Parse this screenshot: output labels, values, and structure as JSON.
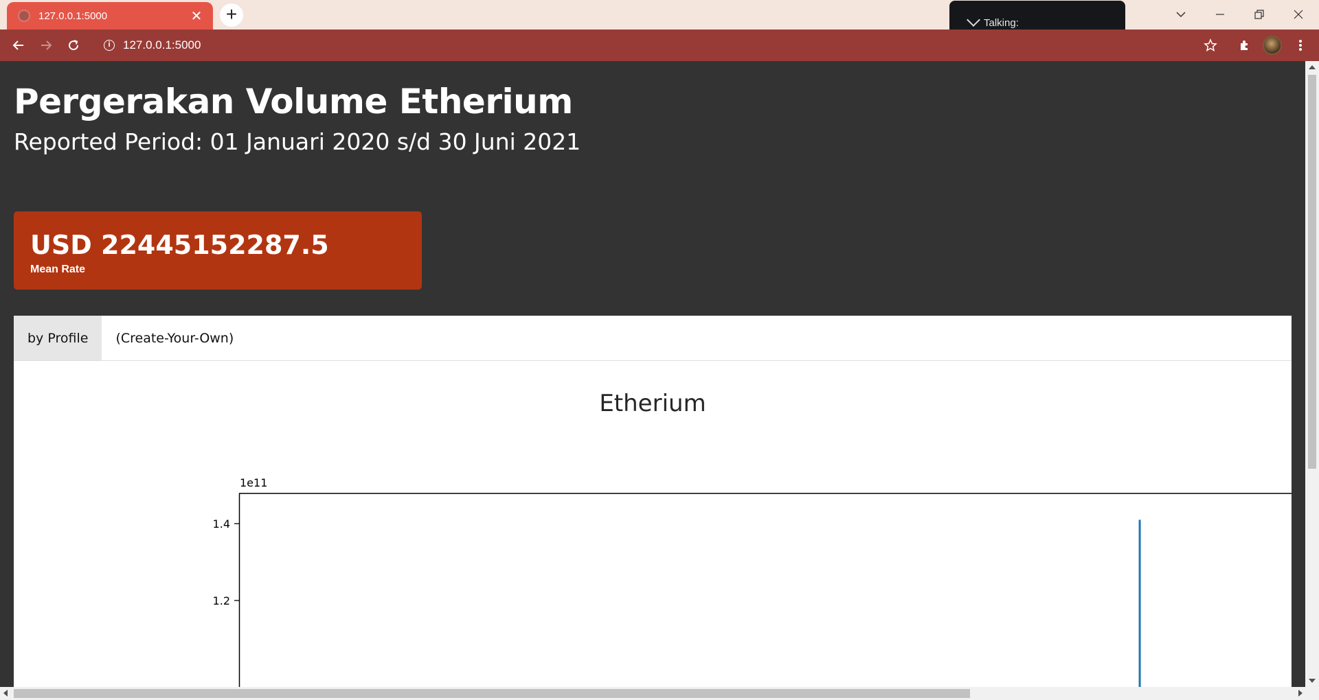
{
  "browser": {
    "tab_title": "127.0.0.1:5000",
    "url": "127.0.0.1:5000",
    "talking_label": "Talking:",
    "accent": "#e45548",
    "toolbar_color": "#983b36"
  },
  "page": {
    "title": "Pergerakan Volume Etherium",
    "subtitle": "Reported Period: 01 Januari 2020 s/d 30 Juni 2021"
  },
  "metric_card": {
    "value": "USD 22445152287.5",
    "caption": "Mean Rate",
    "color": "#b23511"
  },
  "tabs": [
    {
      "label": "by Profile",
      "active": true
    },
    {
      "label": "(Create-Your-Own)",
      "active": false
    }
  ],
  "chart_data": {
    "type": "line",
    "title": "Etherium",
    "offset_label": "1e11",
    "ylim_visible": [
      1.05,
      1.48
    ],
    "yticks": [
      {
        "value": 1.4,
        "label": "1.4"
      },
      {
        "value": 1.2,
        "label": "1.2"
      }
    ],
    "series": [
      {
        "values": [
          {
            "position": 0.853,
            "y": 1.41
          }
        ]
      }
    ],
    "series_color": "#1f77b4"
  }
}
